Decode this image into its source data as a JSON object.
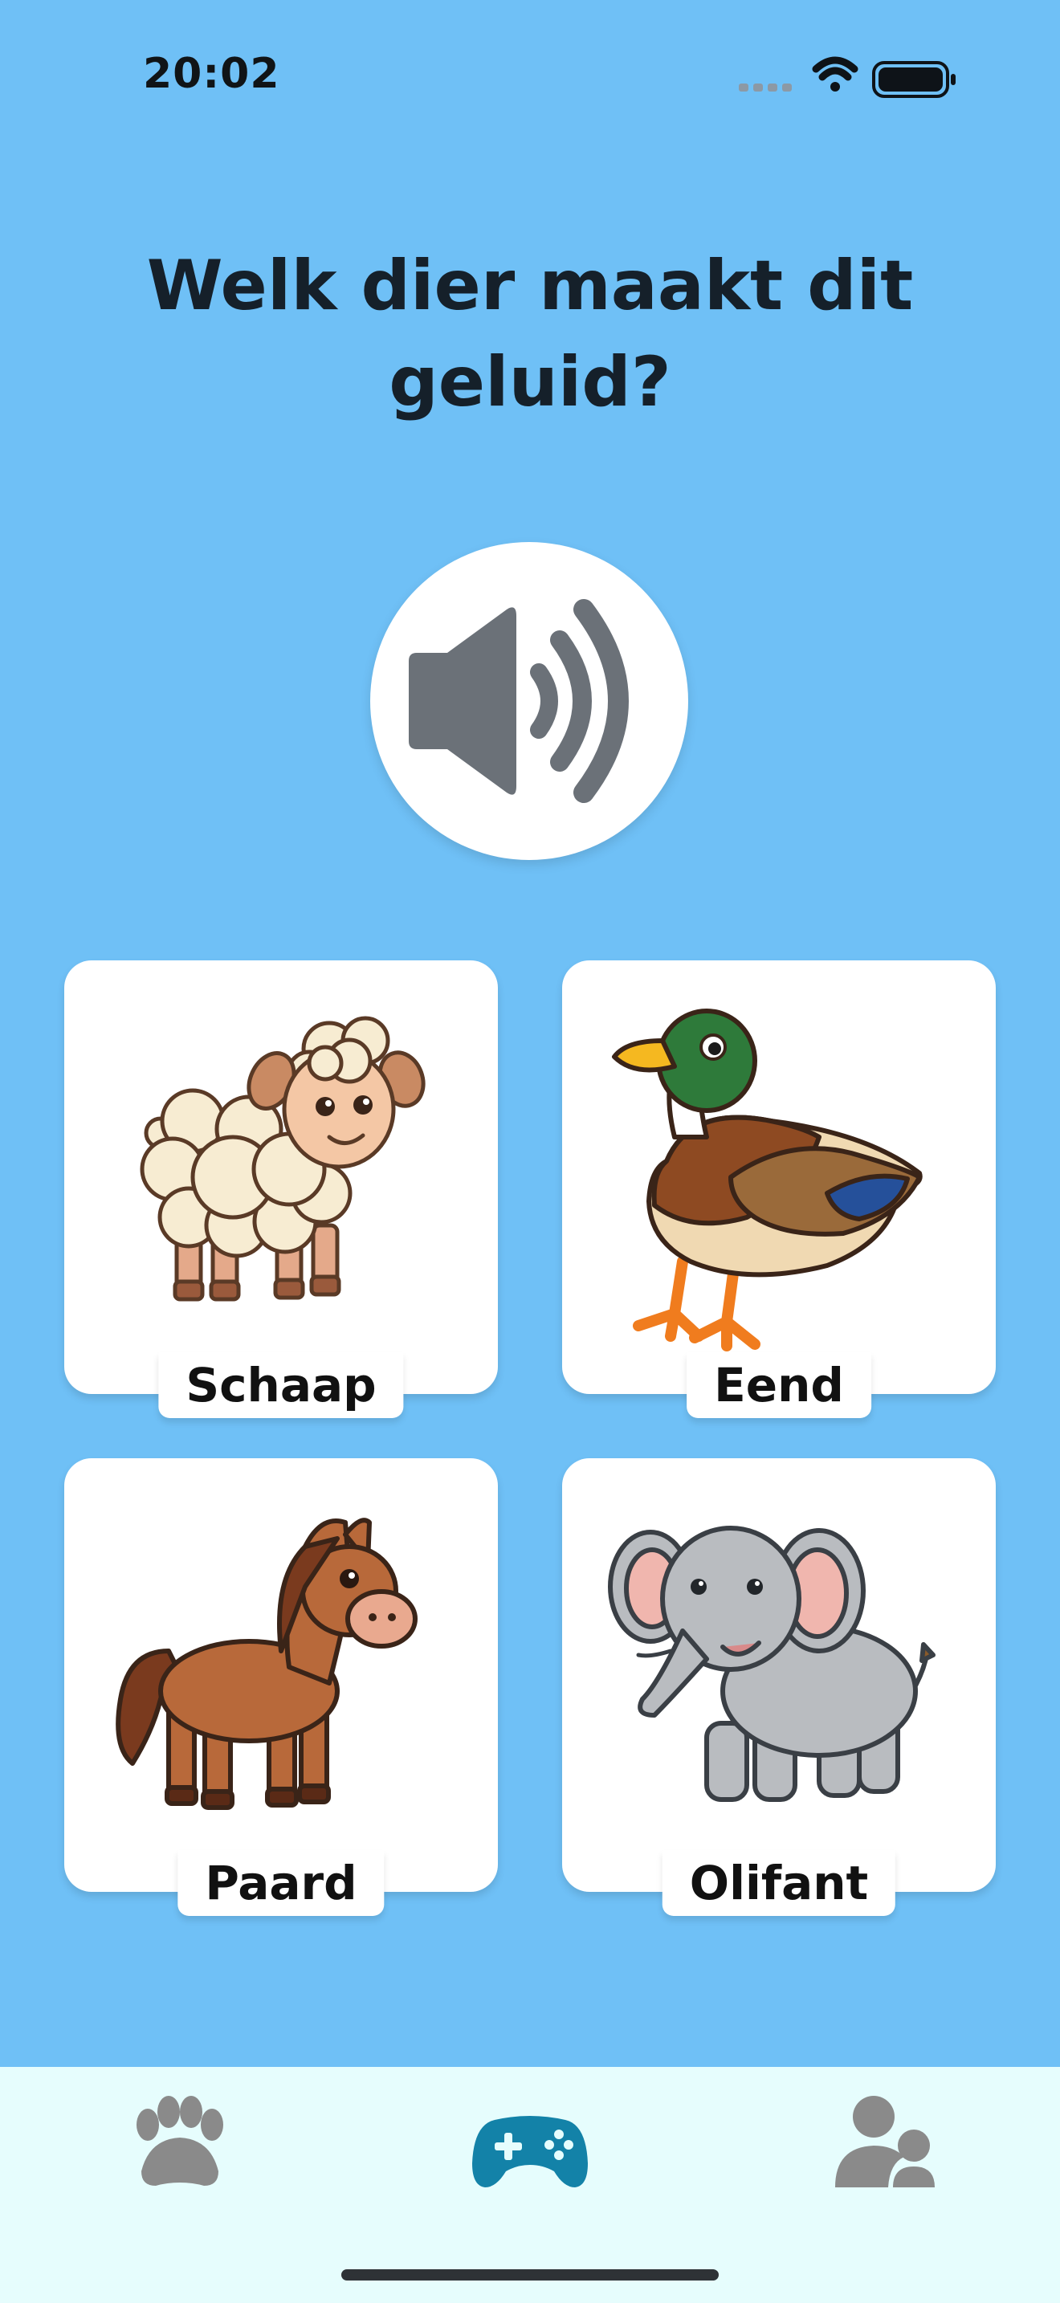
{
  "status_bar": {
    "time": "20:02",
    "signal_icon": "cellular-signal-icon",
    "wifi_icon": "wifi-icon",
    "battery_icon": "battery-icon"
  },
  "quiz": {
    "question": "Welk dier maakt dit geluid?",
    "play_sound_icon": "speaker-volume-icon"
  },
  "answers": [
    {
      "label": "Schaap",
      "icon": "sheep-illustration"
    },
    {
      "label": "Eend",
      "icon": "duck-illustration"
    },
    {
      "label": "Paard",
      "icon": "horse-illustration"
    },
    {
      "label": "Olifant",
      "icon": "elephant-illustration"
    }
  ],
  "tab_bar": {
    "tabs": [
      {
        "icon": "paw-icon",
        "active": false
      },
      {
        "icon": "gamepad-icon",
        "active": true
      },
      {
        "icon": "users-icon",
        "active": false
      }
    ]
  },
  "colors": {
    "background": "#6fc0f6",
    "card": "#ffffff",
    "tab_bar_background": "#e6fdfd",
    "tab_active": "#1382a8",
    "tab_inactive": "#8a8a8a",
    "speaker_icon": "#6b7178"
  }
}
